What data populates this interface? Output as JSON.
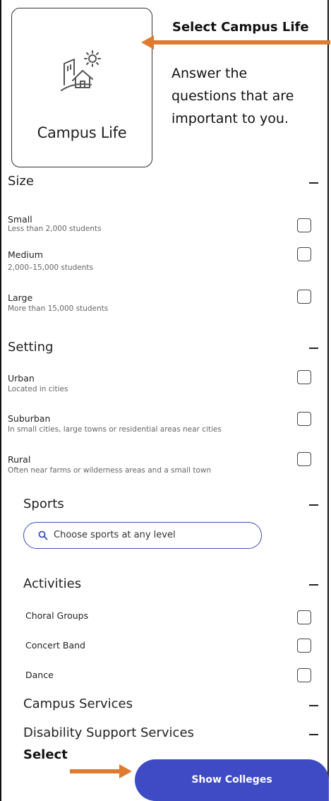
{
  "tile": {
    "label": "Campus Life",
    "icon": "campus-house-sun-icon"
  },
  "callout": {
    "title": "Select Campus Life",
    "lines": [
      "Answer the",
      "questions that are",
      "important to you."
    ]
  },
  "sections": {
    "size": {
      "title": "Size",
      "options": [
        {
          "label": "Small",
          "sub": "Less than 2,000 students"
        },
        {
          "label": "Medium",
          "sub": "2,000–15,000 students"
        },
        {
          "label": "Large",
          "sub": "More than 15,000 students"
        }
      ]
    },
    "setting": {
      "title": "Setting",
      "options": [
        {
          "label": "Urban",
          "sub": "Located in cities"
        },
        {
          "label": "Suburban",
          "sub": "In small cities, large towns or residential areas near cities"
        },
        {
          "label": "Rural",
          "sub": "Often near farms or wilderness areas and a small town"
        }
      ]
    },
    "sports": {
      "title": "Sports",
      "search_placeholder": "Choose sports at any level"
    },
    "activities": {
      "title": "Activities",
      "options": [
        "Choral Groups",
        "Concert Band",
        "Dance"
      ]
    },
    "campus_services": {
      "title": "Campus Services"
    },
    "disability": {
      "title": "Disability Support Services"
    }
  },
  "footer": {
    "select_label": "Select",
    "button_label": "Show Colleges"
  },
  "colors": {
    "accent": "#3e4bc4",
    "arrow": "#e07a30"
  }
}
